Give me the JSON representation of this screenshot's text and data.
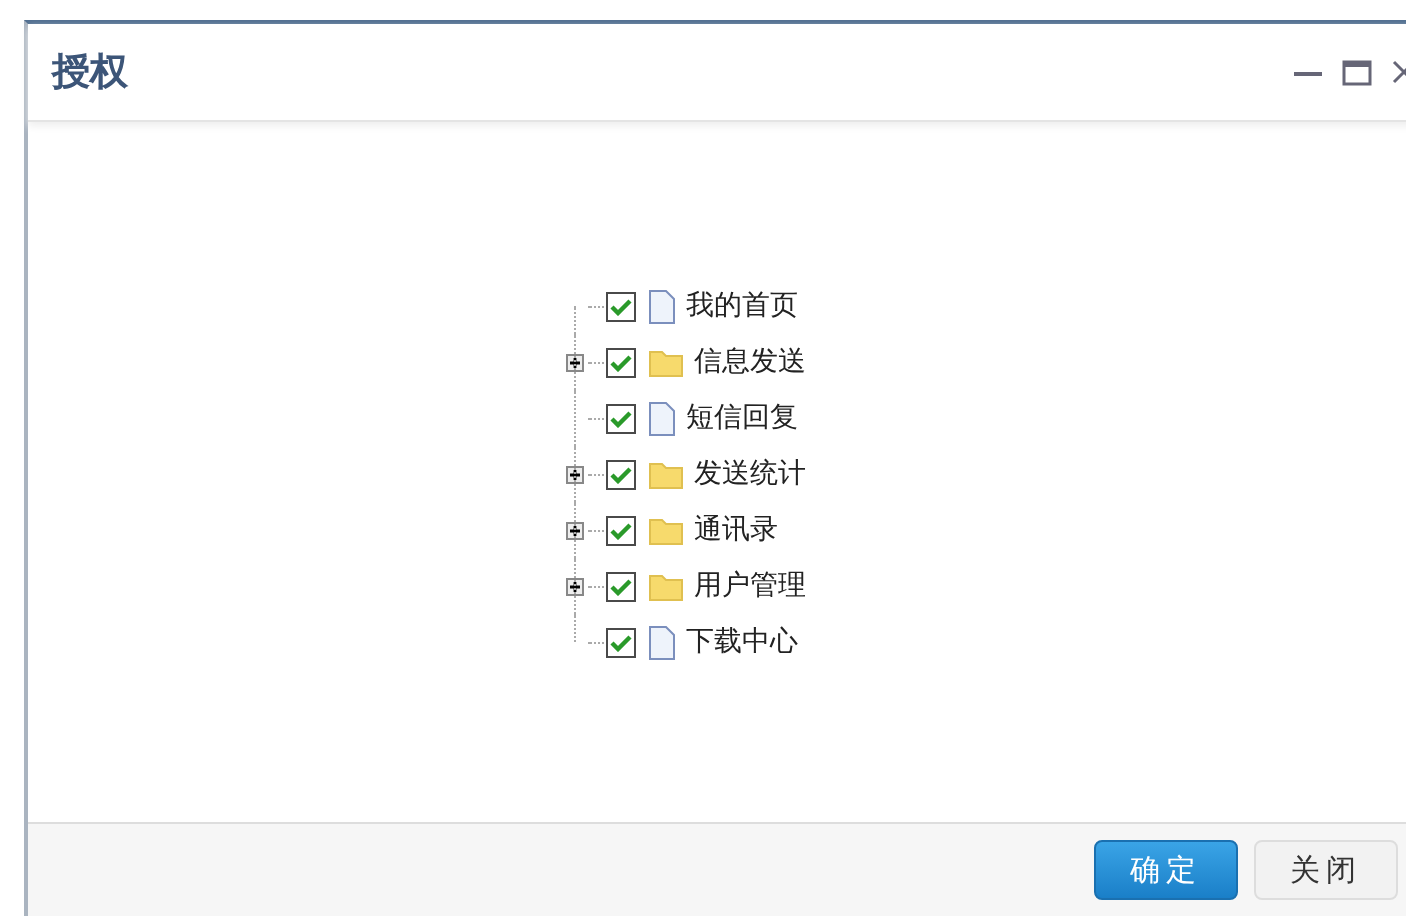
{
  "window": {
    "title": "授权"
  },
  "tree": [
    {
      "label": "我的首页",
      "kind": "file",
      "checked": true
    },
    {
      "label": "信息发送",
      "kind": "folder",
      "checked": true,
      "expanded": false
    },
    {
      "label": "短信回复",
      "kind": "file",
      "checked": true
    },
    {
      "label": "发送统计",
      "kind": "folder",
      "checked": true,
      "expanded": false
    },
    {
      "label": "通讯录",
      "kind": "folder",
      "checked": true,
      "expanded": false
    },
    {
      "label": "用户管理",
      "kind": "folder",
      "checked": true,
      "expanded": false
    },
    {
      "label": "下载中心",
      "kind": "file",
      "checked": true
    }
  ],
  "buttons": [
    {
      "label": "确定",
      "kind": "primary"
    },
    {
      "label": "关闭",
      "kind": "secondary"
    }
  ]
}
